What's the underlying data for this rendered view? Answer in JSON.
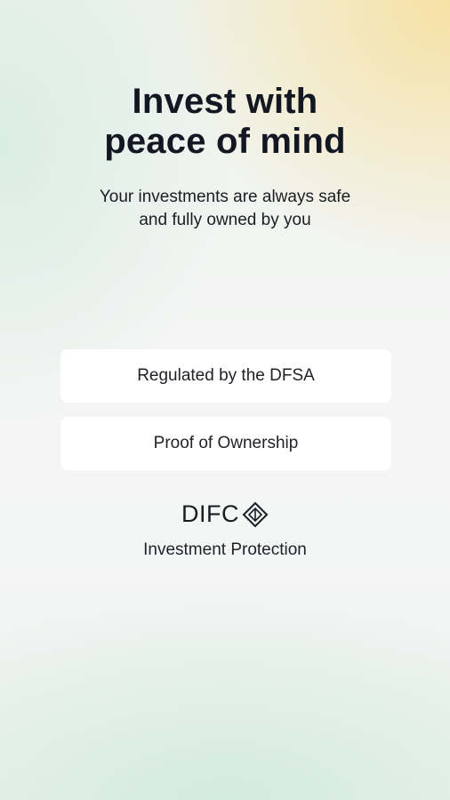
{
  "hero": {
    "title_line1": "Invest with",
    "title_line2": "peace of mind",
    "subtitle_line1": "Your investments are always safe",
    "subtitle_line2": "and fully owned by you"
  },
  "features": [
    {
      "label": "Regulated by the DFSA"
    },
    {
      "label": "Proof of Ownership"
    }
  ],
  "protection": {
    "logo_text": "DIFC",
    "logo_icon": "difc-emblem-icon",
    "label": "Investment Protection"
  },
  "colors": {
    "text": "#131722",
    "card": "#ffffff",
    "accent_yellow": "#f8de96",
    "accent_mint": "#d6ece2"
  }
}
